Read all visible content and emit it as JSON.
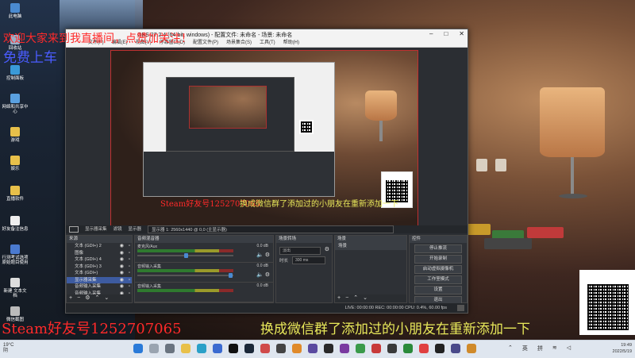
{
  "desktop": {
    "icons": [
      {
        "label": "此电脑"
      },
      {
        "label": "回收站"
      },
      {
        "label": "控制面板"
      },
      {
        "label": "网络和共享中心"
      },
      {
        "label": "游戏"
      },
      {
        "label": "娱乐"
      },
      {
        "label": "直播软件"
      },
      {
        "label": "好友备注信息"
      },
      {
        "label": "行测考试选项 原始题目使用"
      },
      {
        "label": "新建 文本文档"
      },
      {
        "label": "微信截图"
      }
    ]
  },
  "overlay": {
    "top_banner": "欢迎大家来到我直播间，点赞加关注！",
    "free_ride": "免费上车",
    "steam_small": "Steam好友号1252707065",
    "wechat_small": "换成微信群了添加过的小朋友在重新添加一下",
    "steam_big": "Steam好友号1252707065",
    "wechat_big": "换成微信群了添加过的小朋友在重新添加一下"
  },
  "obs": {
    "window_title": "OBS 27.2.4 (64-bit, windows) - 配置文件: 未命名 - 场景: 未命名",
    "menu": [
      "文件(F)",
      "编辑(E)",
      "视图(V)",
      "停靠窗口(D)",
      "配置文件(P)",
      "场景集合(S)",
      "工具(T)",
      "帮助(H)"
    ],
    "status": {
      "scene_label": "显示器采集",
      "filter_label": "滤镜",
      "display_label": "显示器",
      "display_value": "显示器 1: 2560x1440 @ 0,0 (主显示器)"
    },
    "sources": {
      "title": "来源",
      "items": [
        {
          "label": "文本 (GDI+) 2",
          "selected": false
        },
        {
          "label": "图像",
          "selected": false
        },
        {
          "label": "文本 (GDI+) 4",
          "selected": false
        },
        {
          "label": "文本 (GDI+) 3",
          "selected": false
        },
        {
          "label": "文本 (GDI+)",
          "selected": false
        },
        {
          "label": "显示器采集",
          "selected": true
        },
        {
          "label": "音频输入采集",
          "selected": false
        },
        {
          "label": "音频输入采集",
          "selected": false
        }
      ]
    },
    "mixer": {
      "title": "音频混音器",
      "tracks": [
        {
          "name": "麦克风/Aux",
          "db": "0.0 dB",
          "level": 0.55
        },
        {
          "name": "音频输入采集",
          "db": "0.0 dB",
          "level": 0.5
        },
        {
          "name": "音频输入采集",
          "db": "0.0 dB",
          "level": 0.5
        }
      ]
    },
    "transitions": {
      "title": "场景转场",
      "type_value": "淡出",
      "duration_label": "时长",
      "duration_value": "300 ms"
    },
    "scenes": {
      "title": "场景",
      "items": [
        "场景"
      ]
    },
    "controls": {
      "title": "控件",
      "buttons": [
        "停止推流",
        "开始录制",
        "启动虚拟摄像机",
        "工作室模式",
        "设置",
        "退出"
      ]
    },
    "bottom_status": "LIVE: 00:00:00   REC: 00:00:00   CPU: 0.4%, 60.00 fps"
  },
  "taskbar": {
    "temperature": "19°C",
    "weather": "阴",
    "input_lang": "英",
    "input_mode": "拼",
    "time": "19:49",
    "date": "2022/5/19"
  }
}
